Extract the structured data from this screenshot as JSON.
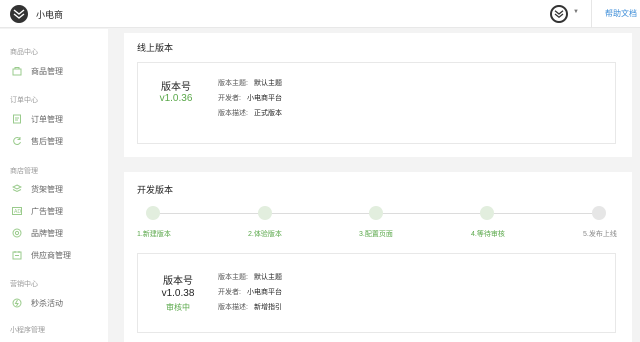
{
  "header": {
    "app_title": "小电商",
    "help_link": "帮助文档"
  },
  "sidebar": {
    "groups": [
      {
        "title": "商品中心",
        "items": [
          {
            "label": "商品管理",
            "icon": "shop-bag-icon"
          }
        ]
      },
      {
        "title": "订单中心",
        "items": [
          {
            "label": "订单管理",
            "icon": "order-doc-icon"
          },
          {
            "label": "售后管理",
            "icon": "refresh-service-icon"
          }
        ]
      },
      {
        "title": "商店管理",
        "items": [
          {
            "label": "货架管理",
            "icon": "shelf-layers-icon"
          },
          {
            "label": "广告管理",
            "icon": "ad-icon"
          },
          {
            "label": "品牌管理",
            "icon": "brand-badge-icon"
          },
          {
            "label": "供应商管理",
            "icon": "supplier-icon"
          }
        ]
      },
      {
        "title": "营销中心",
        "items": [
          {
            "label": "秒杀活动",
            "icon": "flash-sale-icon"
          }
        ]
      },
      {
        "title": "小程序管理",
        "items": []
      }
    ]
  },
  "online": {
    "title": "线上版本",
    "version_label": "版本号",
    "version_number": "v1.0.36",
    "meta": [
      {
        "key": "版本主题:",
        "value": "默认主题"
      },
      {
        "key": "开发者:",
        "value": "小电商平台"
      },
      {
        "key": "版本描述:",
        "value": "正式版本"
      }
    ]
  },
  "dev": {
    "title": "开发版本",
    "steps": [
      "1.新建版本",
      "2.体验版本",
      "3.配置页面",
      "4.等待审核",
      "5.发布上线"
    ],
    "version_label": "版本号",
    "version_number": "v1.0.38",
    "status": "审核中",
    "meta": [
      {
        "key": "版本主题:",
        "value": "默认主题"
      },
      {
        "key": "开发者:",
        "value": "小电商平台"
      },
      {
        "key": "版本描述:",
        "value": "新增指引"
      }
    ]
  },
  "colors": {
    "accent_green": "#5aa84a",
    "link_blue": "#3c8dd8"
  }
}
